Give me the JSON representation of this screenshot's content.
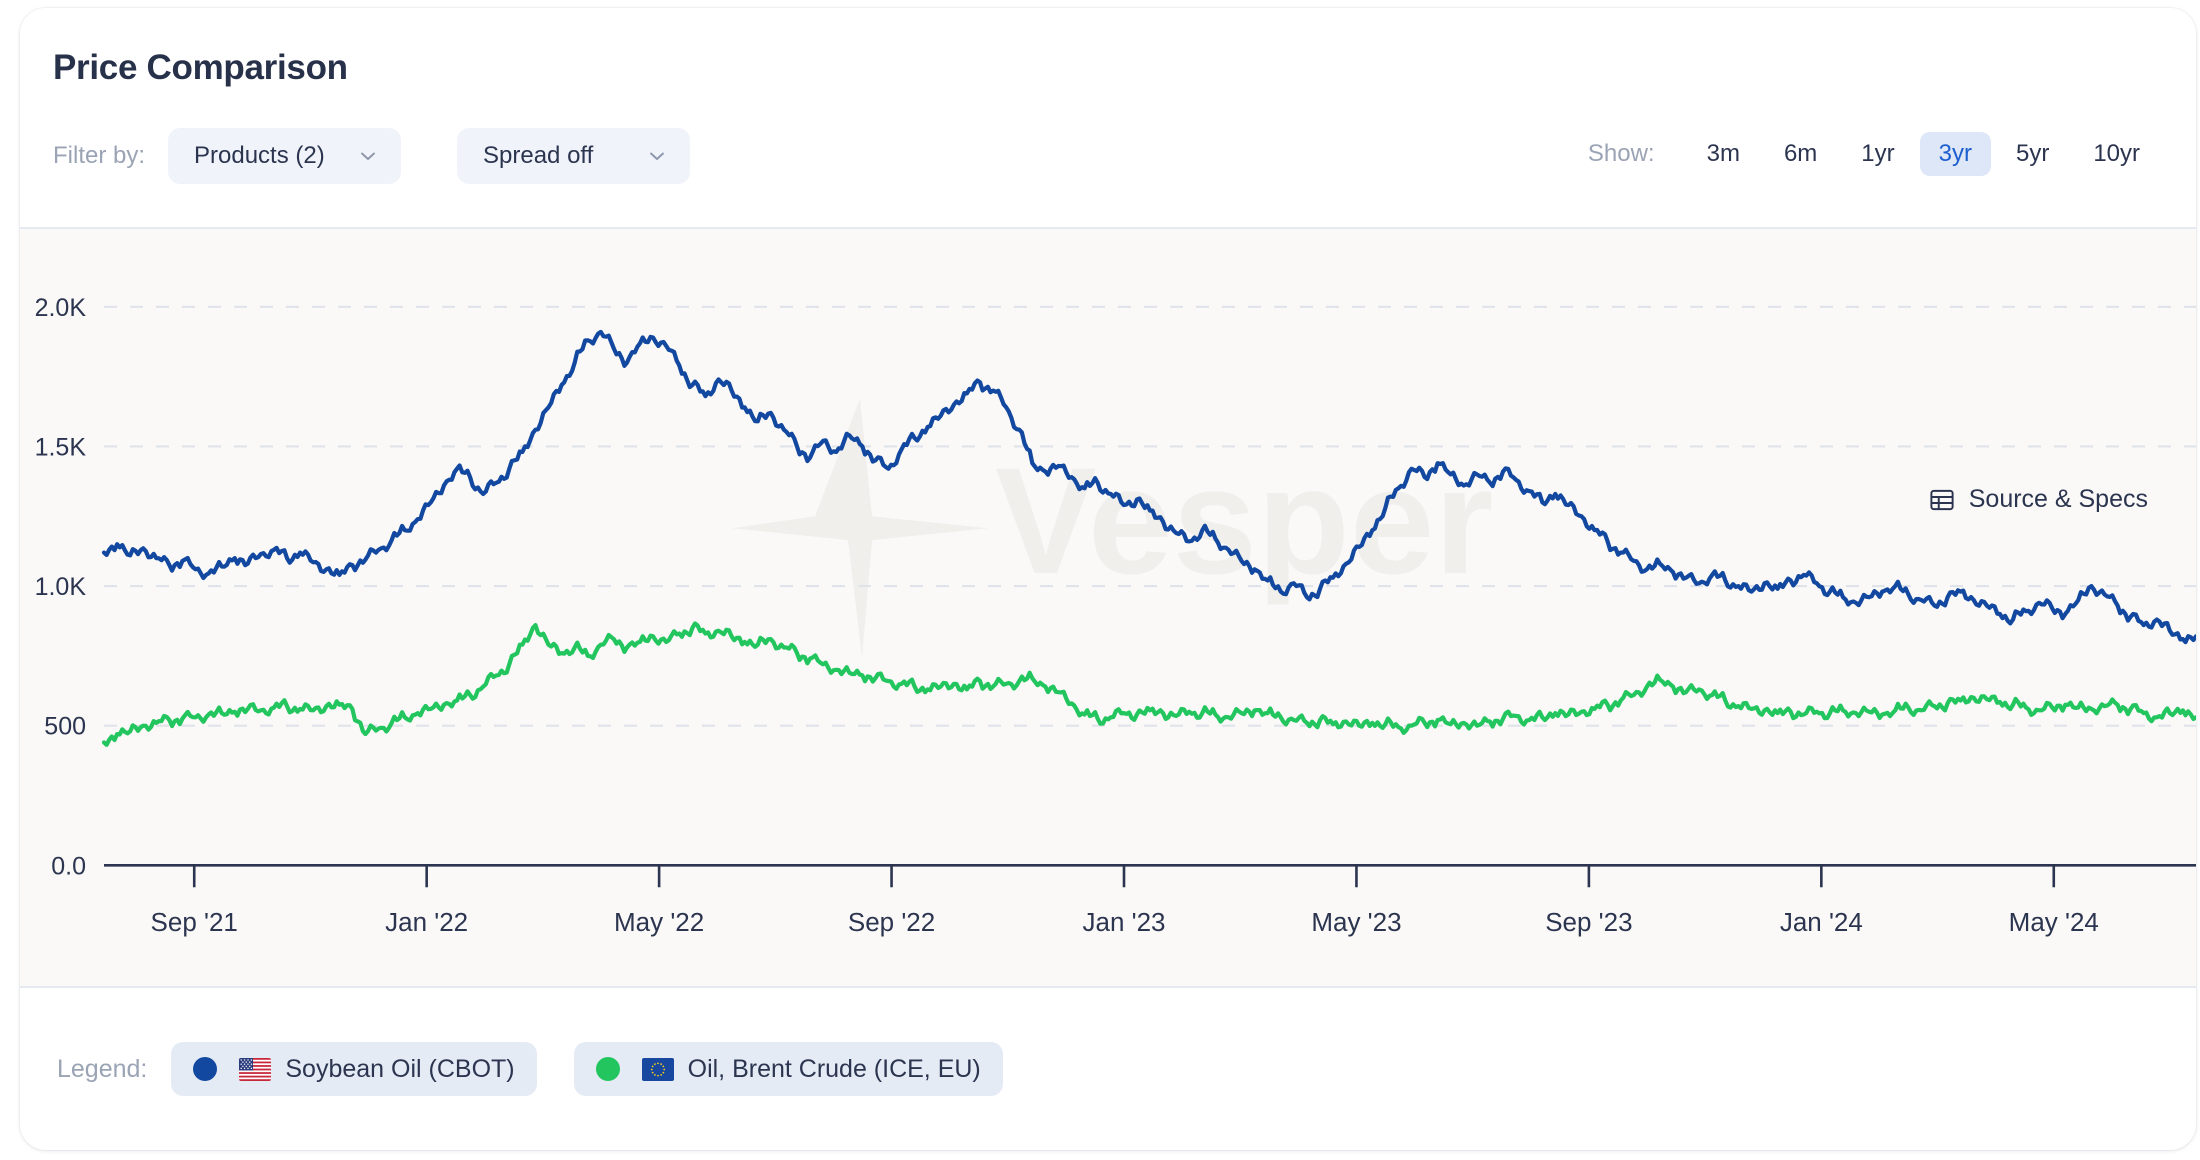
{
  "header": {
    "title": "Price Comparison",
    "filter_label": "Filter by:",
    "products_dropdown": "Products (2)",
    "spread_dropdown": "Spread off",
    "show_label": "Show:",
    "ranges": [
      {
        "label": "3m",
        "active": false
      },
      {
        "label": "6m",
        "active": false
      },
      {
        "label": "1yr",
        "active": false
      },
      {
        "label": "3yr",
        "active": true
      },
      {
        "label": "5yr",
        "active": false
      },
      {
        "label": "10yr",
        "active": false
      }
    ]
  },
  "plot": {
    "source_specs_label": "Source & Specs",
    "source_specs_icon": "table-icon",
    "watermark_text": "Vesper"
  },
  "legend": {
    "label": "Legend:",
    "items": [
      {
        "name": "Soybean Oil (CBOT)",
        "color": "#12489f",
        "flag": "us-flag-icon"
      },
      {
        "name": "Oil, Brent Crude (ICE, EU)",
        "color": "#22c55e",
        "flag": "eu-flag-icon"
      }
    ]
  },
  "chart_data": {
    "type": "line",
    "title": "Price Comparison",
    "xlabel": "",
    "ylabel": "",
    "ylim": [
      0,
      2150
    ],
    "ytick_values": [
      0,
      500,
      1000,
      1500,
      2000
    ],
    "ytick_labels": [
      "0.0",
      "500",
      "1.0K",
      "1.5K",
      "2.0K"
    ],
    "grid": "horizontal-dashed",
    "grid_color": "#dfe3ea",
    "axis_color": "#2c3550",
    "legend_position": "bottom",
    "xtick_labels": [
      "Sep '21",
      "Jan '22",
      "May '22",
      "Sep '22",
      "Jan '23",
      "May '23",
      "Sep '23",
      "Jan '24",
      "May '24"
    ],
    "x_start": "2021-08",
    "x_end": "2024-08",
    "n_points": 157,
    "series": [
      {
        "name": "Soybean Oil (CBOT)",
        "color": "#12489f",
        "values": [
          1120,
          1150,
          1110,
          1135,
          1100,
          1075,
          1090,
          1060,
          1045,
          1070,
          1100,
          1080,
          1115,
          1130,
          1100,
          1120,
          1085,
          1060,
          1040,
          1075,
          1095,
          1130,
          1165,
          1200,
          1240,
          1300,
          1360,
          1420,
          1390,
          1330,
          1370,
          1420,
          1480,
          1560,
          1640,
          1720,
          1800,
          1880,
          1910,
          1850,
          1800,
          1870,
          1890,
          1860,
          1790,
          1720,
          1680,
          1740,
          1700,
          1640,
          1590,
          1620,
          1560,
          1500,
          1460,
          1520,
          1480,
          1540,
          1500,
          1450,
          1420,
          1490,
          1530,
          1570,
          1610,
          1650,
          1690,
          1730,
          1700,
          1640,
          1560,
          1440,
          1410,
          1430,
          1390,
          1350,
          1370,
          1330,
          1290,
          1310,
          1270,
          1230,
          1190,
          1160,
          1200,
          1170,
          1130,
          1090,
          1060,
          1020,
          980,
          1010,
          960,
          990,
          1030,
          1080,
          1140,
          1200,
          1280,
          1350,
          1420,
          1390,
          1440,
          1400,
          1360,
          1400,
          1370,
          1410,
          1380,
          1340,
          1300,
          1330,
          1290,
          1250,
          1200,
          1160,
          1120,
          1090,
          1060,
          1080,
          1050,
          1030,
          1010,
          1040,
          1020,
          1000,
          980,
          1010,
          990,
          1020,
          1040,
          1010,
          980,
          960,
          940,
          960,
          980,
          1000,
          970,
          950,
          930,
          960,
          980,
          950,
          930,
          900,
          880,
          910,
          940,
          920,
          900,
          950,
          1000,
          970,
          930,
          890,
          860,
          880,
          840,
          810,
          820
        ]
      },
      {
        "name": "Oil, Brent Crude (ICE, EU)",
        "color": "#22c55e",
        "values": [
          440,
          470,
          480,
          500,
          510,
          520,
          525,
          530,
          540,
          545,
          550,
          560,
          555,
          565,
          570,
          560,
          555,
          570,
          575,
          560,
          470,
          490,
          510,
          530,
          545,
          560,
          575,
          590,
          610,
          640,
          680,
          720,
          790,
          860,
          790,
          760,
          780,
          750,
          790,
          810,
          780,
          800,
          820,
          800,
          830,
          850,
          830,
          840,
          820,
          800,
          790,
          810,
          780,
          760,
          740,
          720,
          700,
          690,
          680,
          670,
          660,
          650,
          640,
          630,
          640,
          650,
          630,
          660,
          640,
          650,
          660,
          670,
          640,
          620,
          580,
          540,
          525,
          530,
          545,
          540,
          555,
          545,
          535,
          550,
          545,
          540,
          530,
          545,
          555,
          545,
          530,
          520,
          510,
          520,
          505,
          515,
          500,
          510,
          505,
          495,
          500,
          510,
          520,
          505,
          510,
          500,
          515,
          525,
          535,
          520,
          530,
          545,
          540,
          550,
          560,
          575,
          590,
          610,
          640,
          665,
          640,
          620,
          630,
          610,
          590,
          570,
          560,
          555,
          545,
          550,
          540,
          550,
          545,
          555,
          545,
          550,
          540,
          555,
          565,
          555,
          570,
          580,
          590,
          600,
          595,
          585,
          575,
          565,
          555,
          565,
          575,
          565,
          560,
          570,
          575,
          560,
          545,
          530,
          545,
          555,
          530
        ]
      }
    ]
  }
}
